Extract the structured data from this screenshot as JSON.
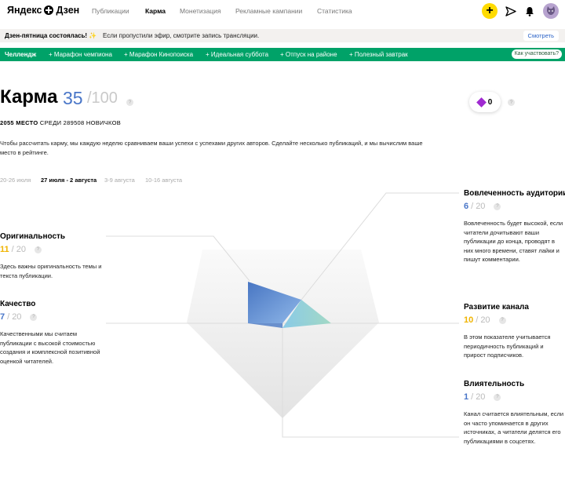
{
  "header": {
    "logo": "Яндекс",
    "logo_suffix": "Дзен",
    "nav": [
      "Публикации",
      "Карма",
      "Монетизация",
      "Рекламные кампании",
      "Статистика"
    ],
    "active_nav": "Карма"
  },
  "banner": {
    "title": "Дзен-пятница состоялась! ✨",
    "text": "Если пропустили эфир, смотрите запись трансляции.",
    "button": "Смотреть"
  },
  "challenge": {
    "label": "Челлендж",
    "items": [
      "Марафон чемпиона",
      "Марафон Кинопоиска",
      "Идеальная суббота",
      "Отпуск на районе",
      "Полезный завтрак"
    ],
    "button": "Как участвовать?"
  },
  "karma": {
    "title": "Карма",
    "score": "35",
    "max": "/100",
    "place_bold": "2055 МЕСТО",
    "place_rest": "СРЕДИ 289508 НОВИЧКОВ",
    "description": "Чтобы рассчитать карму, мы каждую неделю сравниваем ваши успехи с успехами других авторов. Сделайте несколько публикаций, и мы вычислим ваше место в рейтинге.",
    "gems": "0"
  },
  "weeks": [
    "20-26 июля",
    "27 июля - 2 августа",
    "3-9 августа",
    "10-16 августа"
  ],
  "active_week": "27 июля - 2 августа",
  "metrics": {
    "originality": {
      "name": "Оригинальность",
      "value": "11",
      "max": "20",
      "text": "Здесь важны оригинальность темы и текста публикации."
    },
    "quality": {
      "name": "Качество",
      "value": "7",
      "max": "20",
      "text": "Качественными мы считаем публикации с высокой стоимостью создания и комплексной позитивной оценкой читателей."
    },
    "engagement": {
      "name": "Вовлеченность аудитории",
      "value": "6",
      "max": "20",
      "text": "Вовлеченность будет высокой, если читатели дочитывают ваши публикации до конца, проводят в них много времени, ставят лайки и пишут комментарии."
    },
    "growth": {
      "name": "Развитие канала",
      "value": "10",
      "max": "20",
      "text": "В этом показателе учитывается периодичность публикаций и прирост подписчиков."
    },
    "influence": {
      "name": "Влиятельность",
      "value": "1",
      "max": "20",
      "text": "Канал считается влиятельным, если он часто упоминается в других источниках, а читатели делятся его публикациями в соцсетях."
    }
  },
  "colors": {
    "accent_blue": "#4976c8",
    "yellow": "#f0b400",
    "green": "#00a268",
    "gem": "#a02ad1"
  }
}
